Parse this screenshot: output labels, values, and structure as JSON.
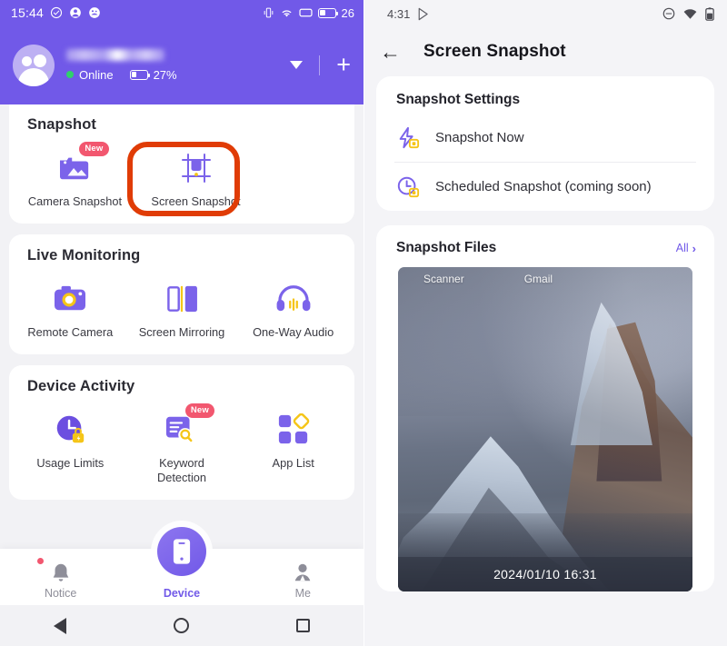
{
  "left_phone": {
    "status_bar": {
      "time": "15:44",
      "icons_left": [
        "check-circle-icon",
        "account-icon",
        "speedometer-icon"
      ],
      "icons_right": [
        "vibrate-icon",
        "wifi-icon",
        "sim-icon",
        "battery-icon"
      ],
      "battery_percent": "26"
    },
    "header": {
      "device_name_masked": "",
      "status_label": "Online",
      "battery_label": "27%",
      "caret_icon": "chevron-down-icon",
      "add_icon": "plus-icon"
    },
    "sections": [
      {
        "title": "Snapshot",
        "tiles": [
          {
            "label": "Camera Snapshot",
            "icon": "camera-photo-icon",
            "badge": "New",
            "highlighted": false
          },
          {
            "label": "Screen Snapshot",
            "icon": "screen-capture-icon",
            "badge": "",
            "highlighted": true
          }
        ]
      },
      {
        "title": "Live Monitoring",
        "tiles": [
          {
            "label": "Remote Camera",
            "icon": "camera-icon",
            "badge": "",
            "highlighted": false
          },
          {
            "label": "Screen Mirroring",
            "icon": "screen-mirroring-icon",
            "badge": "",
            "highlighted": false
          },
          {
            "label": "One-Way Audio",
            "icon": "headphones-icon",
            "badge": "",
            "highlighted": false
          }
        ]
      },
      {
        "title": "Device Activity",
        "tiles": [
          {
            "label": "Usage Limits",
            "icon": "clock-lock-icon",
            "badge": "",
            "highlighted": false
          },
          {
            "label": "Keyword\nDetection",
            "icon": "keyword-search-icon",
            "badge": "New",
            "highlighted": false
          },
          {
            "label": "App List",
            "icon": "app-grid-icon",
            "badge": "",
            "highlighted": false
          }
        ]
      }
    ],
    "bottom_nav": [
      {
        "label": "Notice",
        "icon": "bell-icon",
        "active": false,
        "dot": true
      },
      {
        "label": "Device",
        "icon": "phone-icon",
        "active": true,
        "dot": false
      },
      {
        "label": "Me",
        "icon": "person-icon",
        "active": false,
        "dot": false
      }
    ],
    "system_nav": [
      "back-icon",
      "home-icon",
      "recents-icon"
    ]
  },
  "right_phone": {
    "status_bar": {
      "time": "4:31",
      "icons_left": [
        "play-store-icon"
      ],
      "icons_right": [
        "do-not-disturb-icon",
        "wifi-icon",
        "battery-icon"
      ]
    },
    "app_bar": {
      "back_icon": "back-arrow-icon",
      "title": "Screen Snapshot"
    },
    "settings_card": {
      "title": "Snapshot Settings",
      "rows": [
        {
          "label": "Snapshot Now",
          "icon": "lightning-capture-icon"
        },
        {
          "label": "Scheduled Snapshot (coming soon)",
          "icon": "clock-capture-icon"
        }
      ]
    },
    "files_card": {
      "title": "Snapshot Files",
      "all_label": "All",
      "all_chevron": "chevron-right-icon",
      "thumbnail": {
        "app_labels": [
          "Scanner",
          "Gmail"
        ],
        "timestamp": "2024/01/10 16:31",
        "alt": "snowy mountain peak wallpaper screenshot"
      }
    }
  },
  "colors": {
    "brand_purple": "#7159e8",
    "highlight_orange": "#e03c06",
    "badge_pink": "#f2576f",
    "accent_yellow": "#f5c518",
    "online_green": "#2fd16a",
    "page_bg": "#f2f2f5"
  }
}
